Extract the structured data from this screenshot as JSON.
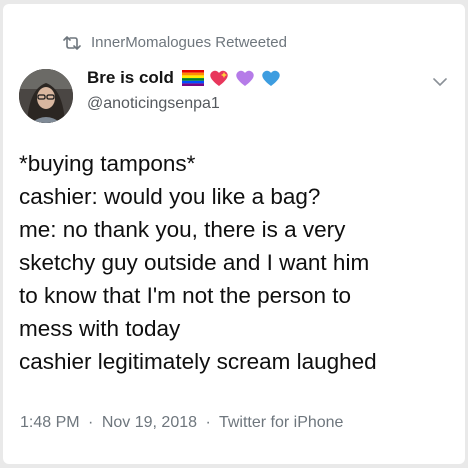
{
  "retweet": {
    "text": "InnerMomalogues Retweeted"
  },
  "author": {
    "name": "Bre is cold",
    "handle": "@anoticingsenpa1",
    "emoji_icons": [
      "rainbow-flag-icon",
      "sparkling-heart-icon",
      "purple-heart-icon",
      "blue-heart-icon"
    ]
  },
  "tweet": {
    "lines": [
      "*buying tampons*",
      "cashier: would you like a bag?",
      "me: no thank you, there is a very",
      "sketchy guy outside and I want him",
      "to know that I'm not the person to",
      "mess with today",
      "cashier legitimately scream laughed"
    ]
  },
  "meta": {
    "time": "1:48 PM",
    "separator": "·",
    "date": "Nov 19, 2018",
    "source": "Twitter for iPhone"
  },
  "colors": {
    "text": "#0f0f0f",
    "secondary": "#6e767d",
    "heart_purple": "#b57be8",
    "heart_blue": "#3d9de0",
    "heart_pink": "#e8375c"
  }
}
